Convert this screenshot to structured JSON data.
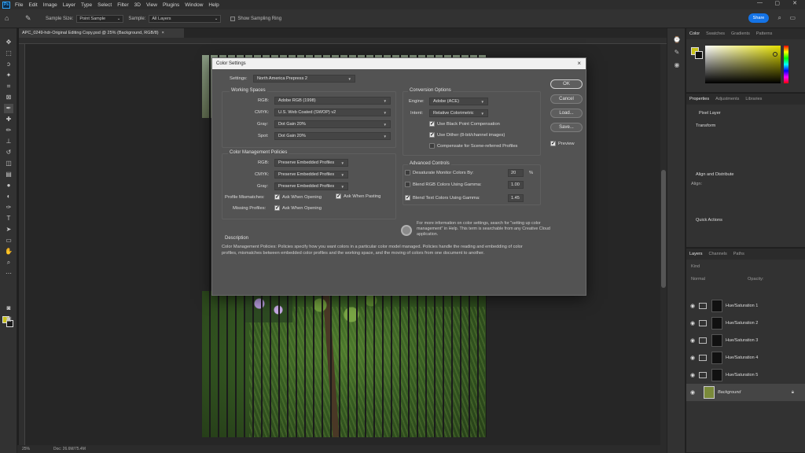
{
  "app": {
    "logo": "Ps",
    "menu": [
      "File",
      "Edit",
      "Image",
      "Layer",
      "Type",
      "Select",
      "Filter",
      "3D",
      "View",
      "Plugins",
      "Window",
      "Help"
    ]
  },
  "options_bar": {
    "sample_size_label": "Sample Size:",
    "sample_size_value": "Point Sample",
    "sample_label": "Sample:",
    "sample_value": "All Layers",
    "show_ring_label": "Show Sampling Ring",
    "share_label": "Share"
  },
  "document": {
    "tab_title": "APC_0249-hdr-Original Editing Copy.psd @ 25% (Background, RGB/8)",
    "close": "×"
  },
  "status": {
    "zoom": "25%",
    "doc": "Doc: 26.6M/75.4M"
  },
  "dialog": {
    "title": "Color Settings",
    "close": "×",
    "settings_label": "Settings:",
    "settings_value": "North America Prepress 2",
    "working_spaces": {
      "title": "Working Spaces",
      "rgb_label": "RGB:",
      "rgb_value": "Adobe RGB (1998)",
      "cmyk_label": "CMYK:",
      "cmyk_value": "U.S. Web Coated (SWOP) v2",
      "gray_label": "Gray:",
      "gray_value": "Dot Gain 20%",
      "spot_label": "Spot:",
      "spot_value": "Dot Gain 20%"
    },
    "policies": {
      "title": "Color Management Policies",
      "rgb_label": "RGB:",
      "rgb_value": "Preserve Embedded Profiles",
      "cmyk_label": "CMYK:",
      "cmyk_value": "Preserve Embedded Profiles",
      "gray_label": "Gray:",
      "gray_value": "Preserve Embedded Profiles",
      "mismatch_label": "Profile Mismatches:",
      "ask_opening": "Ask When Opening",
      "ask_pasting": "Ask When Pasting",
      "missing_label": "Missing Profiles:",
      "ask_opening2": "Ask When Opening"
    },
    "conversion": {
      "title": "Conversion Options",
      "engine_label": "Engine:",
      "engine_value": "Adobe (ACE)",
      "intent_label": "Intent:",
      "intent_value": "Relative Colorimetric",
      "bpc": "Use Black Point Compensation",
      "dither": "Use Dither (8-bit/channel images)",
      "scene": "Compensate for Scene-referred Profiles"
    },
    "advanced": {
      "title": "Advanced Controls",
      "desat_label": "Desaturate Monitor Colors By:",
      "desat_value": "20",
      "desat_unit": "%",
      "blend_rgb_label": "Blend RGB Colors Using Gamma:",
      "blend_rgb_value": "1.00",
      "blend_text_label": "Blend Text Colors Using Gamma:",
      "blend_text_value": "1.45"
    },
    "info_text": "For more information on color settings, search for \"setting up color management\" in Help. This term is searchable from any Creative Cloud application.",
    "description": {
      "title": "Description",
      "text": "Color Management Policies:  Policies specify how you want colors in a particular color model managed.  Policies handle the reading and embedding of color profiles, mismatches between embedded color profiles and the working space, and the moving of colors from one document to another."
    },
    "buttons": {
      "ok": "OK",
      "cancel": "Cancel",
      "load": "Load...",
      "save": "Save...",
      "preview": "Preview"
    }
  },
  "panels": {
    "color_tabs": [
      "Color",
      "Swatches",
      "Gradients",
      "Patterns"
    ],
    "props_tabs": [
      "Properties",
      "Adjustments",
      "Libraries"
    ],
    "pixel_layer": "Pixel Layer",
    "transform": "Transform",
    "align": "Align and Distribute",
    "align_sub": "Align:",
    "quick_actions": "Quick Actions",
    "layers_tabs": [
      "Layers",
      "Channels",
      "Paths"
    ],
    "kind": "Kind",
    "normal": "Normal",
    "opacity": "Opacity:",
    "layers": [
      {
        "name": "Hue/Saturation 1"
      },
      {
        "name": "Hue/Saturation 2"
      },
      {
        "name": "Hue/Saturation 3"
      },
      {
        "name": "Hue/Saturation 4"
      },
      {
        "name": "Hue/Saturation 5"
      },
      {
        "name": "Background"
      }
    ]
  },
  "colors": {
    "foreground": "#c9c21a",
    "accent": "#1473e6"
  }
}
